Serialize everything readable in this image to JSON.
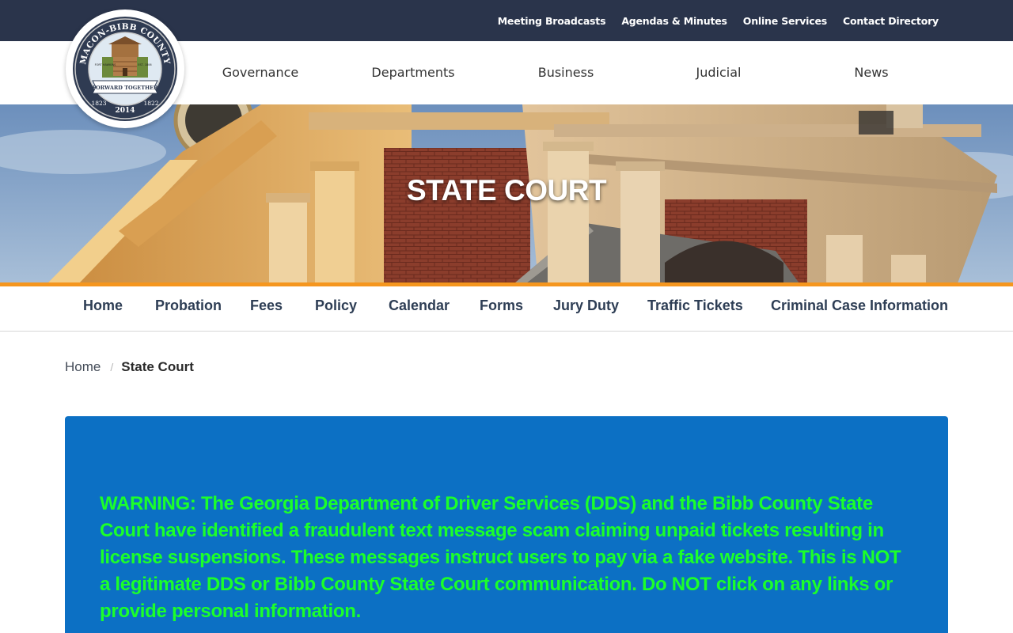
{
  "utility_nav": {
    "items": [
      "Meeting Broadcasts",
      "Agendas & Minutes",
      "Online Services",
      "Contact Directory"
    ]
  },
  "logo": {
    "top_text": "MACON-BIBB COUNTY",
    "left_small": "FORT HAWKINS",
    "right_small": "EST. 1806",
    "banner": "FORWARD TOGETHER",
    "year_left": "1823",
    "year_center": "2014",
    "year_right": "1822"
  },
  "main_nav": {
    "items": [
      "Governance",
      "Departments",
      "Business",
      "Judicial",
      "News"
    ]
  },
  "hero": {
    "title": "STATE COURT"
  },
  "section_nav": {
    "items": [
      "Home",
      "Probation",
      "Fees",
      "Policy",
      "Calendar",
      "Forms",
      "Jury Duty",
      "Traffic Tickets",
      "Criminal Case Information"
    ]
  },
  "breadcrumb": {
    "home": "Home",
    "separator": "/",
    "current": "State Court"
  },
  "alert": {
    "text": "WARNING: The Georgia Department of Driver Services (DDS) and the Bibb County State Court have identified a fraudulent text message scam claiming unpaid tickets resulting in license suspensions. These messages instruct users to pay via a fake website. This is NOT a legitimate DDS or Bibb County State Court communication. Do NOT click on any links or provide personal information."
  },
  "colors": {
    "utility_bar": "#2a344b",
    "orange_rule": "#f5961e",
    "section_nav_text": "#2e3e55",
    "alert_background": "#0c70c4",
    "alert_text": "#1bff2a"
  }
}
